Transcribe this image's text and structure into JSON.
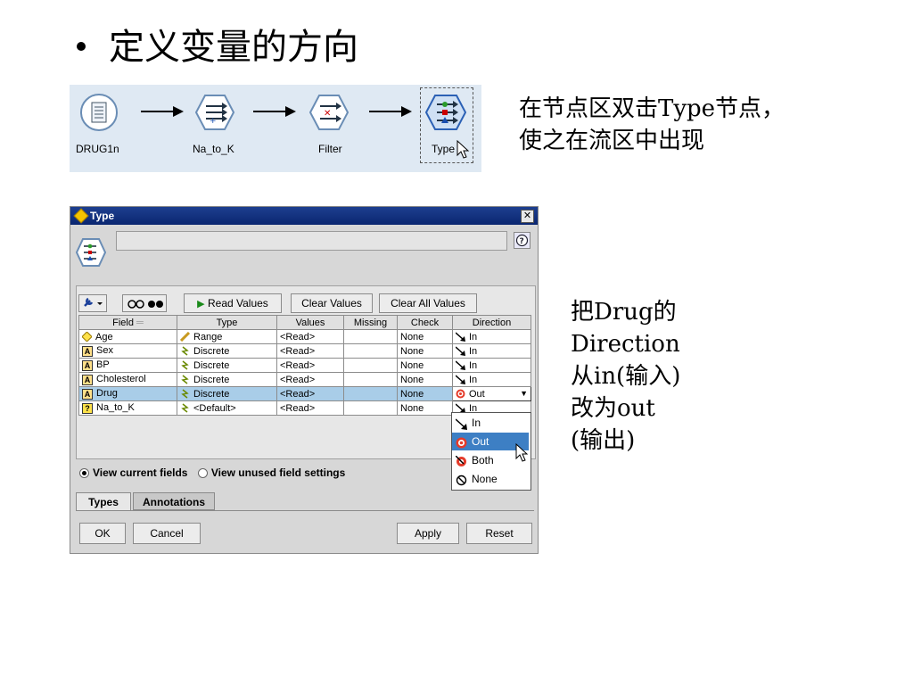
{
  "slide": {
    "title": "定义变量的方向",
    "note_top_lines": [
      "在节点区双击Type节点，",
      "使之在流区中出现"
    ],
    "note_side_lines": [
      "把Drug的",
      "Direction",
      "从in(输入)",
      "改为out",
      "(输出)"
    ]
  },
  "stream": {
    "nodes": [
      {
        "label": "DRUG1n",
        "icon": "file-source-icon"
      },
      {
        "label": "Na_to_K",
        "icon": "derive-icon"
      },
      {
        "label": "Filter",
        "icon": "filter-icon"
      },
      {
        "label": "Type",
        "icon": "type-icon"
      }
    ]
  },
  "dialog": {
    "title": "Type",
    "close_glyph": "✕",
    "help_glyph": "?",
    "toolbar": {
      "read_values": "Read Values",
      "clear_values": "Clear Values",
      "clear_all_values": "Clear All Values"
    },
    "columns": [
      "Field",
      "Type",
      "Values",
      "Missing",
      "Check",
      "Direction"
    ],
    "rows": [
      {
        "field": "Age",
        "field_icon": "range-field-icon",
        "type": "Range",
        "values": "<Read>",
        "missing": "",
        "check": "None",
        "direction": "In"
      },
      {
        "field": "Sex",
        "field_icon": "string-field-icon",
        "type": "Discrete",
        "values": "<Read>",
        "missing": "",
        "check": "None",
        "direction": "In"
      },
      {
        "field": "BP",
        "field_icon": "string-field-icon",
        "type": "Discrete",
        "values": "<Read>",
        "missing": "",
        "check": "None",
        "direction": "In"
      },
      {
        "field": "Cholesterol",
        "field_icon": "string-field-icon",
        "type": "Discrete",
        "values": "<Read>",
        "missing": "",
        "check": "None",
        "direction": "In"
      },
      {
        "field": "Drug",
        "field_icon": "string-field-icon",
        "type": "Discrete",
        "values": "<Read>",
        "missing": "",
        "check": "None",
        "direction": "Out",
        "selected": true
      },
      {
        "field": "Na_to_K",
        "field_icon": "unknown-field-icon",
        "type": "<Default>",
        "values": "<Read>",
        "missing": "",
        "check": "None",
        "direction": "In"
      }
    ],
    "direction_options": [
      "In",
      "Out",
      "Both",
      "None"
    ],
    "direction_highlighted": "Out",
    "view_options": [
      "View current fields",
      "View unused field settings"
    ],
    "view_selected": "View current fields",
    "tabs": [
      "Types",
      "Annotations"
    ],
    "active_tab": "Types",
    "buttons": {
      "ok": "OK",
      "cancel": "Cancel",
      "apply": "Apply",
      "reset": "Reset"
    },
    "colors": {
      "title_bar": "#0a2670",
      "selected_row": "#a9cde8",
      "dropdown_highlight": "#3d7fc4"
    }
  }
}
